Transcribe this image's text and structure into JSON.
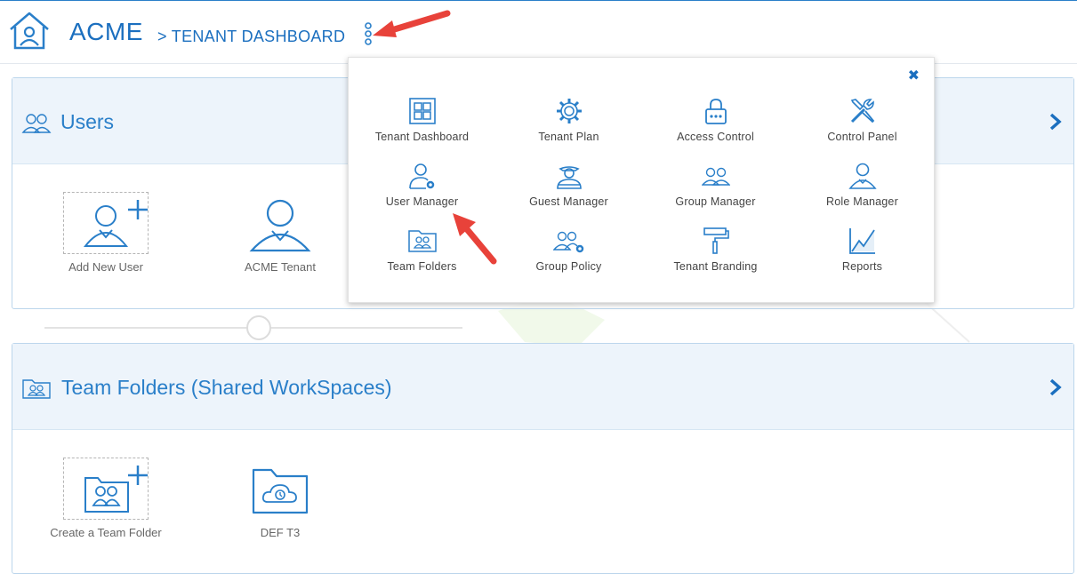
{
  "header": {
    "brand": "ACME",
    "breadcrumb": "> TENANT DASHBOARD"
  },
  "users_card": {
    "title": "Users",
    "tiles": [
      {
        "label": "Add New User"
      },
      {
        "label": "ACME Tenant"
      }
    ]
  },
  "team_folders_card": {
    "title": "Team Folders (Shared WorkSpaces)",
    "tiles": [
      {
        "label": "Create a Team Folder"
      },
      {
        "label": "DEF T3"
      }
    ]
  },
  "menu": {
    "close_symbol": "✖",
    "items": [
      {
        "label": "Tenant Dashboard",
        "icon": "dashboard-icon"
      },
      {
        "label": "Tenant Plan",
        "icon": "gear-icon"
      },
      {
        "label": "Access Control",
        "icon": "lock-icon"
      },
      {
        "label": "Control Panel",
        "icon": "tools-icon"
      },
      {
        "label": "User Manager",
        "icon": "user-gear-icon"
      },
      {
        "label": "Guest Manager",
        "icon": "guest-icon"
      },
      {
        "label": "Group Manager",
        "icon": "group-icon"
      },
      {
        "label": "Role Manager",
        "icon": "role-icon"
      },
      {
        "label": "Team Folders",
        "icon": "team-folder-icon"
      },
      {
        "label": "Group Policy",
        "icon": "group-gear-icon"
      },
      {
        "label": "Tenant Branding",
        "icon": "paint-roller-icon"
      },
      {
        "label": "Reports",
        "icon": "chart-icon"
      }
    ]
  },
  "colors": {
    "accent": "#2a7fc9",
    "header_bg": "#edf4fb",
    "annotation_arrow": "#e8423a"
  }
}
